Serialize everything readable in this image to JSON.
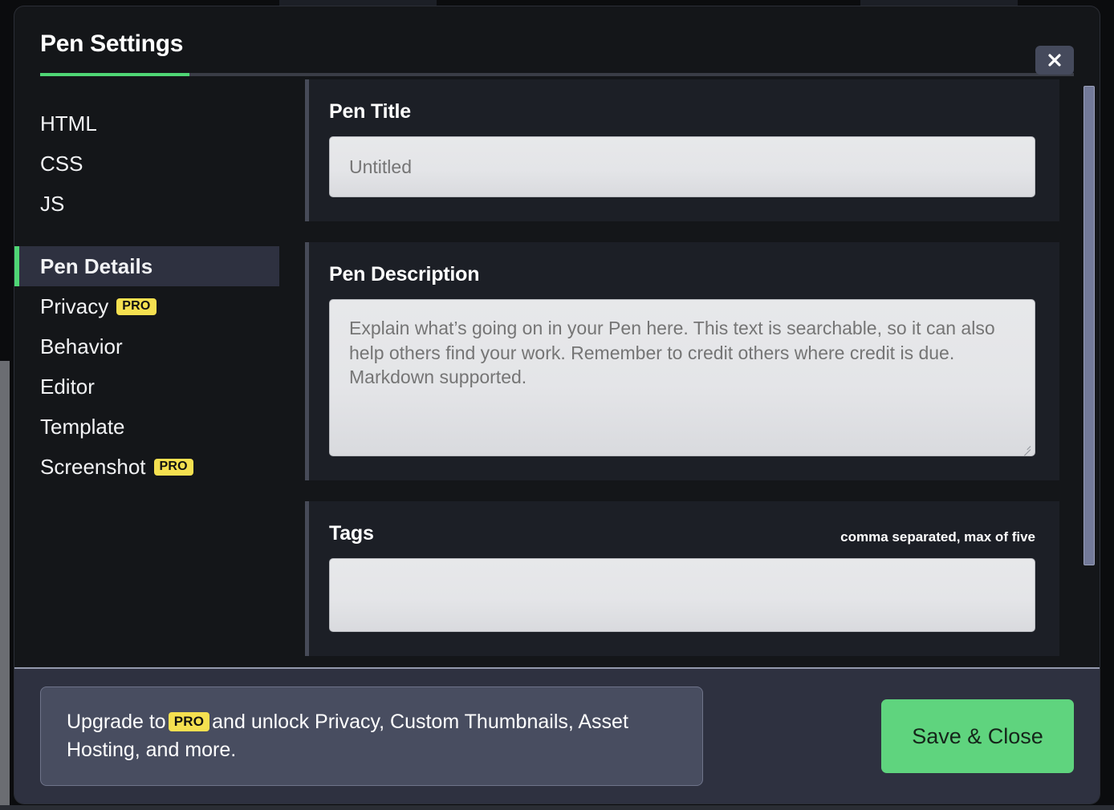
{
  "modal": {
    "title": "Pen Settings",
    "close_label": "×"
  },
  "sidebar": {
    "resources": [
      {
        "label": "HTML"
      },
      {
        "label": "CSS"
      },
      {
        "label": "JS"
      }
    ],
    "settings": [
      {
        "label": "Pen Details",
        "active": true,
        "pro": false
      },
      {
        "label": "Privacy",
        "active": false,
        "pro": true
      },
      {
        "label": "Behavior",
        "active": false,
        "pro": false
      },
      {
        "label": "Editor",
        "active": false,
        "pro": false
      },
      {
        "label": "Template",
        "active": false,
        "pro": false
      },
      {
        "label": "Screenshot",
        "active": false,
        "pro": true
      }
    ],
    "pro_badge": "PRO"
  },
  "fields": {
    "pen_title": {
      "label": "Pen Title",
      "value": "",
      "placeholder": "Untitled"
    },
    "pen_description": {
      "label": "Pen Description",
      "value": "",
      "placeholder": "Explain what’s going on in your Pen here. This text is searchable, so it can also help others find your work. Remember to credit others where credit is due. Markdown supported."
    },
    "tags": {
      "label": "Tags",
      "hint": "comma separated, max of five",
      "value": "",
      "placeholder": ""
    }
  },
  "footer": {
    "upgrade_prefix": "Upgrade to",
    "upgrade_badge": "PRO",
    "upgrade_suffix": "and unlock Privacy, Custom Thumbnails, Asset Hosting, and more.",
    "save_label": "Save & Close"
  },
  "colors": {
    "accent_green": "#4fd675",
    "save_green": "#5fd47e",
    "pro_yellow": "#f5e050",
    "modal_bg": "#141619",
    "card_bg": "#1c1f26",
    "active_nav_bg": "#2e3140",
    "footer_bg": "#2e3140",
    "banner_bg": "#484d60",
    "scrollbar_thumb": "#737a99"
  }
}
